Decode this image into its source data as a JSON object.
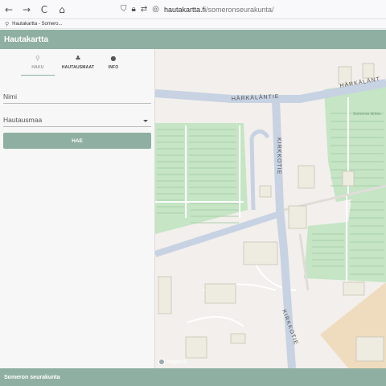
{
  "browser": {
    "back_icon": "←",
    "forward_icon": "→",
    "reload_icon": "C",
    "home_icon": "⌂",
    "url_domain": "hautakartta.fi",
    "url_path": "/someronseurakunta/",
    "tab_title": "Hautakartta - Somero..."
  },
  "app": {
    "title": "Hautakartta"
  },
  "sidebar": {
    "tabs": [
      {
        "label": "HAKU",
        "icon": "search-icon"
      },
      {
        "label": "HAUTAUSMAAT",
        "icon": "cemetery-icon"
      },
      {
        "label": "INFO",
        "icon": "info-icon"
      }
    ],
    "name_placeholder": "Nimi",
    "cemetery_placeholder": "Hautausmaa",
    "search_button": "HAE"
  },
  "map": {
    "labels": {
      "road_top": "HÄRKÄLÄNTIE",
      "road_top_right": "HÄRKÄLÄNT",
      "road_vertical": "KIRKKOTIE",
      "road_vertical_lower": "KIRKKOTIE",
      "church": "Someron kirkko"
    },
    "attribution": "mapbox",
    "colors": {
      "background": "#f2efec",
      "grass": "#c5e5c5",
      "road": "#c7d2e3",
      "building": "#eeebe0"
    }
  },
  "footer": {
    "text": "Someron seurakunta"
  }
}
